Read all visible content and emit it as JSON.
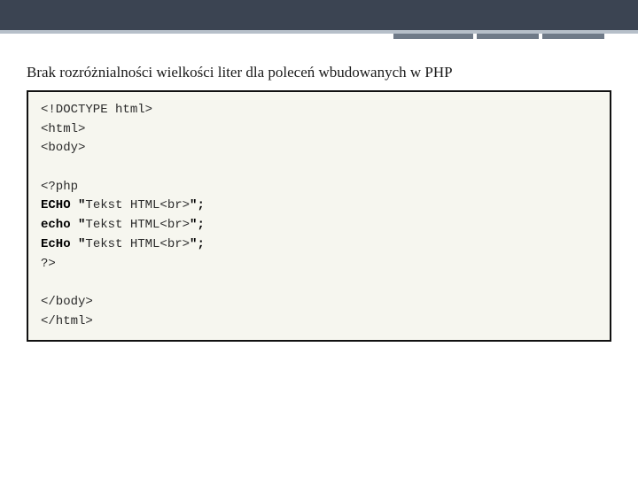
{
  "heading": "Brak rozróżnialności wielkości liter dla poleceń wbudowanych w PHP",
  "code": {
    "l1": "<!DOCTYPE html>",
    "l2": "<html>",
    "l3": "<body>",
    "blank1": "",
    "l4": "<?php",
    "l5a": "ECHO \"",
    "l5b": "Tekst HTML<br>",
    "l5c": "\";",
    "l6a": "echo \"",
    "l6b": "Tekst HTML<br>",
    "l6c": "\";",
    "l7a": "EcHo \"",
    "l7b": "Tekst HTML<br>",
    "l7c": "\";",
    "l8": "?>",
    "blank2": "",
    "l9": "</body>",
    "l10": "</html>"
  }
}
